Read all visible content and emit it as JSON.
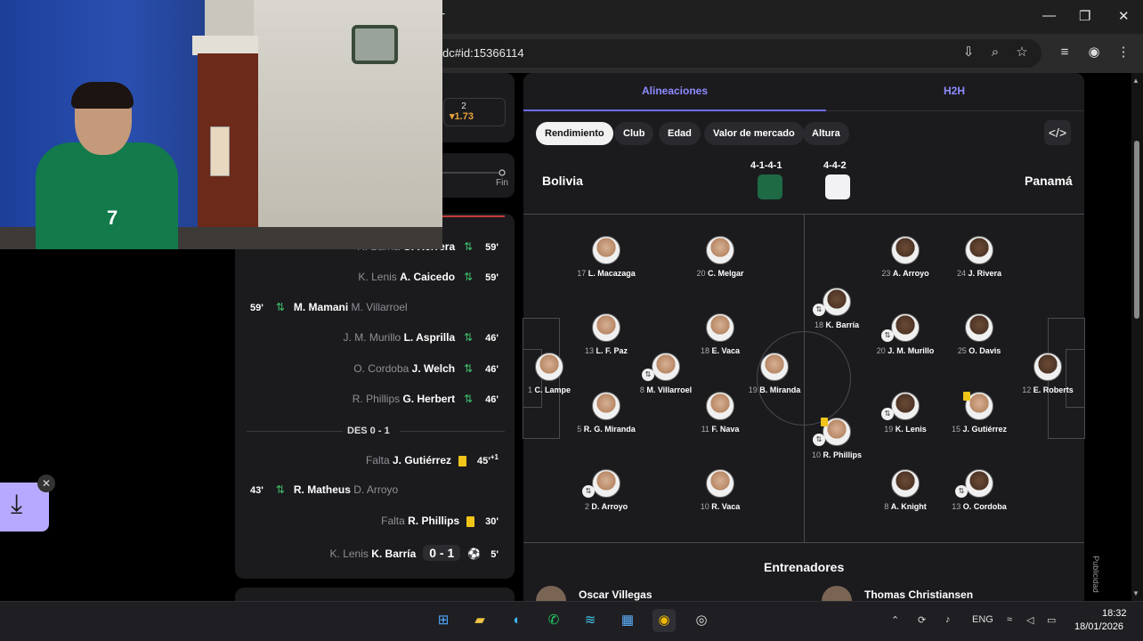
{
  "browser": {
    "url": "dc#id:15366114",
    "new_tab": "+",
    "controls": [
      "—",
      "❐",
      "✕"
    ]
  },
  "odds": {
    "number": "2",
    "value": "▾1.73"
  },
  "timeline": {
    "end_label": "Fin"
  },
  "events": [
    {
      "side": "right",
      "dim": "R. Barría",
      "main": "G. Herrera",
      "type": "sub",
      "minute": "59'"
    },
    {
      "side": "right",
      "dim": "K. Lenis",
      "main": "A. Caicedo",
      "type": "sub",
      "minute": "59'"
    },
    {
      "side": "left",
      "dim": "M. Villarroel",
      "main": "M. Mamani",
      "type": "sub",
      "minute": "59'"
    },
    {
      "side": "right",
      "dim": "J. M. Murillo",
      "main": "L. Asprilla",
      "type": "sub",
      "minute": "46'"
    },
    {
      "side": "right",
      "dim": "O. Cordoba",
      "main": "J. Welch",
      "type": "sub",
      "minute": "46'"
    },
    {
      "side": "right",
      "dim": "R. Phillips",
      "main": "G. Herbert",
      "type": "sub",
      "minute": "46'"
    },
    {
      "side": "right",
      "dim": "Falta",
      "main": "J. Gutiérrez",
      "type": "yellow",
      "minute": "45'",
      "extra": "+1"
    },
    {
      "side": "left",
      "dim": "D. Arroyo",
      "main": "R. Matheus",
      "type": "sub",
      "minute": "43'"
    },
    {
      "side": "right",
      "dim": "Falta",
      "main": "R. Phillips",
      "type": "yellow",
      "minute": "30'"
    },
    {
      "side": "right",
      "dim": "K. Lenis",
      "main": "K. Barría",
      "type": "goal",
      "minute": "5'",
      "score": "0 - 1"
    }
  ],
  "halftime_label": "DES 0 - 1",
  "lineups": {
    "tabs": [
      "Alineaciones",
      "H2H"
    ],
    "chips": [
      "Rendimiento",
      "Club",
      "Edad",
      "Valor de mercado",
      "Altura"
    ],
    "embed_icon": "</>",
    "home": {
      "name": "Bolivia",
      "formation": "4-1-4-1",
      "kit_color": "#1e6a45"
    },
    "away": {
      "name": "Panamá",
      "formation": "4-4-2",
      "kit_color": "#f2f2f5"
    },
    "players": [
      {
        "num": "17",
        "name": "L. Macazaga"
      },
      {
        "num": "20",
        "name": "C. Melgar"
      },
      {
        "num": "13",
        "name": "L. F. Paz"
      },
      {
        "num": "18",
        "name": "E. Vaca"
      },
      {
        "num": "1",
        "name": "C. Lampe"
      },
      {
        "num": "8",
        "name": "M. Villarroel"
      },
      {
        "num": "19",
        "name": "B. Miranda"
      },
      {
        "num": "5",
        "name": "R. G. Miranda"
      },
      {
        "num": "11",
        "name": "F. Nava"
      },
      {
        "num": "2",
        "name": "D. Arroyo"
      },
      {
        "num": "10",
        "name": "R. Vaca"
      },
      {
        "num": "23",
        "name": "A. Arroyo"
      },
      {
        "num": "24",
        "name": "J. Rivera"
      },
      {
        "num": "18",
        "name": "K. Barría"
      },
      {
        "num": "20",
        "name": "J. M. Murillo"
      },
      {
        "num": "25",
        "name": "O. Davis"
      },
      {
        "num": "12",
        "name": "E. Roberts"
      },
      {
        "num": "10",
        "name": "R. Phillips"
      },
      {
        "num": "19",
        "name": "K. Lenis"
      },
      {
        "num": "15",
        "name": "J. Gutiérrez"
      },
      {
        "num": "8",
        "name": "A. Knight"
      },
      {
        "num": "13",
        "name": "O. Cordoba"
      }
    ],
    "coaches_title": "Entrenadores",
    "coaches": [
      "Oscar Villegas",
      "Thomas Christiansen"
    ],
    "ad_label": "Publicidad"
  },
  "webcam": {
    "jersey_number": "7"
  },
  "taskbar": {
    "lang": "ENG",
    "time": "18:32",
    "date": "18/01/2026"
  },
  "colors": {
    "accent": "#6f6bf2",
    "sub": "#3fbf6a",
    "yellow": "#f0c419"
  }
}
